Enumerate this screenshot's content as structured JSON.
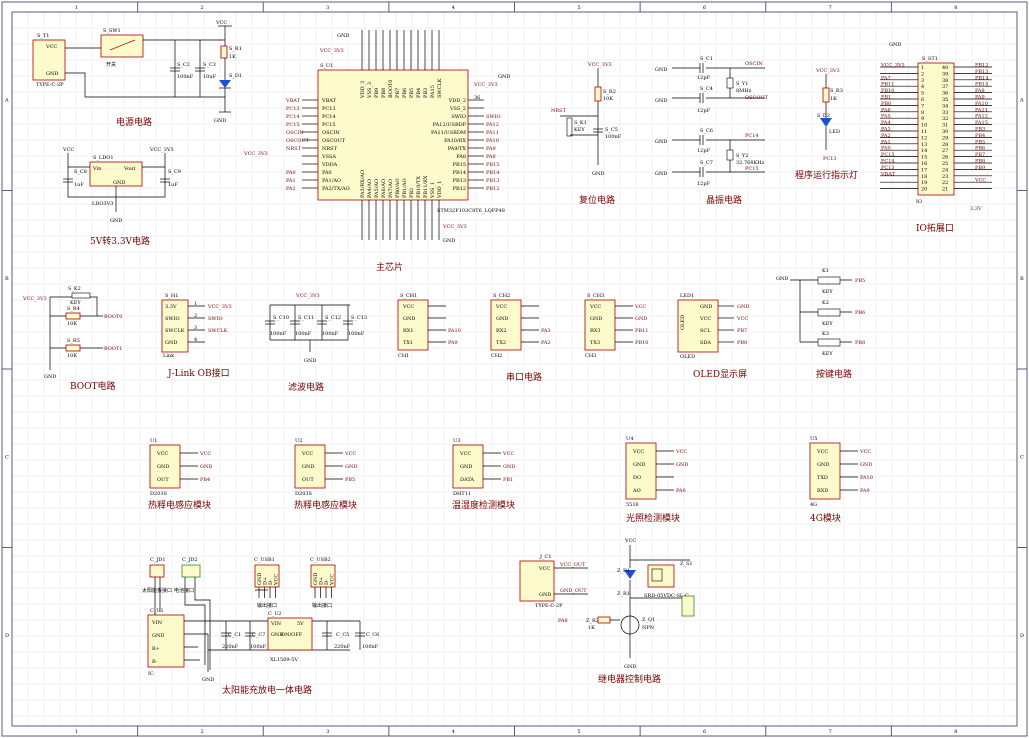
{
  "border": {
    "cols": [
      "1",
      "2",
      "3",
      "4",
      "5",
      "6",
      "7",
      "8"
    ],
    "rows": [
      "A",
      "B",
      "C",
      "D"
    ]
  },
  "sections": {
    "power": "电源电路",
    "ldo": "5V转3.3V电路",
    "mcu": "主芯片",
    "reset": "复位电路",
    "crystal": "晶振电路",
    "led_run": "程序运行指示灯",
    "io": "IO拓展口",
    "boot": "BOOT电路",
    "jlink": "J-Link OB接口",
    "filter": "滤波电路",
    "uart": "串口电路",
    "oled": "OLED显示屏",
    "keys": "按键电路",
    "pir1": "热释电感应模块",
    "pir2": "热释电感应模块",
    "temp": "温湿度检测模块",
    "light": "光照检测模块",
    "g4": "4G模块",
    "solar": "太阳能充放电一体电路",
    "relay": "继电器控制电路"
  },
  "mcu": {
    "ref": "S_U1",
    "part": "STM32F103C8T6_LQFP48",
    "left_pins": [
      "VBAT",
      "PC13",
      "PC14",
      "PC15",
      "OSCIN",
      "OSCOUT",
      "NRST",
      "VSSA",
      "VDDA",
      "PA0",
      "PA1/AO",
      "PA2/TX/AO"
    ],
    "right_pins": [
      "VDD_2",
      "VSS_2",
      "SWIO",
      "PA12/USBDP",
      "PA11/USBDM",
      "PA10/RX",
      "PA9/TX",
      "PA8",
      "PB15",
      "PB14",
      "PB13",
      "PB12"
    ],
    "top_pins": [
      "VDD_3",
      "VSS_3",
      "PB9",
      "PB8",
      "BOOT0",
      "PB7",
      "PB6",
      "PB5",
      "PB4",
      "PB3",
      "PA15",
      "SWCLK"
    ],
    "bottom_pins": [
      "PA3/RX/AO",
      "PA4/AO",
      "PA5/AO",
      "PA6/AO",
      "PA7/AO",
      "PB0/AO",
      "PB1/AO",
      "PB2",
      "PB10/TX",
      "PB11/RX",
      "VSS_1",
      "VDD_1"
    ],
    "left_nets": [
      "VBAT",
      "PC13",
      "PC14",
      "PC15",
      "OSCIN",
      "OSCOUT",
      "NRST",
      "",
      "",
      "PA0",
      "PA1",
      "PA2"
    ],
    "right_nets": [
      "",
      "",
      "SWIO",
      "PA12",
      "PA11",
      "PA10",
      "PA9",
      "PA8",
      "PB15",
      "PB14",
      "PB13",
      "PB12"
    ],
    "vcc_left": "VCC_3V3",
    "vcc_top": "VCC_3V3",
    "vcc_right": "VCC_3V3",
    "vcc_bottom": "VCC_3V3",
    "gnd": "GND",
    "pin_36": "36"
  },
  "power": {
    "j_ref": "S_T1",
    "j_part": "TYPE-C-2P",
    "j_vcc": "VCC",
    "j_gnd": "GND",
    "sw_ref": "S_SW1",
    "sw_part": "开关",
    "c2": "S_C2",
    "c2_val": "100nF",
    "c3": "S_C3",
    "c3_val": "10uF",
    "r1": "S_R1",
    "r1_val": "1K",
    "d1": "S_D1",
    "vcc": "VCC",
    "gnd": "GND"
  },
  "ldo": {
    "ref": "S_LDO1",
    "part": "LDO3V3",
    "vin": "Vin",
    "vout": "Vout",
    "gnd": "GND",
    "c8": "S_C8",
    "c8_val": "1uF",
    "c9": "S_C9",
    "c9_val": "1uF",
    "vcc_in": "VCC",
    "vcc_out": "VCC_3V3",
    "ground": "GND"
  },
  "reset": {
    "vcc": "VCC_3V3",
    "r2": "S_R2",
    "r2_val": "10K",
    "k1": "S_K1",
    "k1_val": "KEY",
    "c5": "S_C5",
    "c5_val": "100nF",
    "nrst": "NRST",
    "gnd": "GND"
  },
  "crystal": {
    "c1": "S_C1",
    "c4": "S_C4",
    "c6": "S_C6",
    "c7": "S_C7",
    "cap_val": "12pF",
    "y1": "S_Y1",
    "y1_val": "8MHz",
    "y2": "S_Y2",
    "y2_val": "32.768KHz",
    "oscin": "OSCIN",
    "oscout": "OSCOUT",
    "pc14": "PC14",
    "pc15": "PC15",
    "gnd": "GND"
  },
  "run_led": {
    "vcc": "VCC_3V3",
    "r3": "S_R3",
    "r3_val": "1K",
    "d2": "S_D2",
    "led": "LED",
    "net": "PC13"
  },
  "io": {
    "ref": "S_ST1",
    "name": "IO",
    "left_nums": [
      "1",
      "2",
      "3",
      "4",
      "5",
      "6",
      "7",
      "8",
      "9",
      "10",
      "11",
      "12",
      "13",
      "14",
      "15",
      "16",
      "17",
      "18",
      "19",
      "20"
    ],
    "right_nums": [
      "40",
      "39",
      "38",
      "37",
      "36",
      "35",
      "34",
      "33",
      "32",
      "31",
      "30",
      "29",
      "28",
      "27",
      "26",
      "25",
      "24",
      "23",
      "22",
      "21"
    ],
    "left_nets": [
      "VCC_3V3",
      "",
      "PA7",
      "PB11",
      "PB10",
      "PB1",
      "PB0",
      "PA6",
      "PA5",
      "PA4",
      "PA3",
      "PA2",
      "PA1",
      "PA0",
      "PC15",
      "PC14",
      "PC13",
      "VBAT",
      "",
      ""
    ],
    "right_nets": [
      "PB12",
      "PB13",
      "PB14",
      "PB15",
      "PA8",
      "PA9",
      "PA10",
      "PA11",
      "PA12",
      "PA15",
      "PB3",
      "PB4",
      "PB5",
      "PB6",
      "PB7",
      "PB8",
      "PB9",
      "",
      "VCC",
      ""
    ],
    "gnd": "GND",
    "vcc_bottom": "3.3V"
  },
  "boot": {
    "vcc": "VCC_3V3",
    "k2": "S_K2",
    "k2_val": "KEY",
    "r4": "S_R4",
    "r4_val": "10K",
    "r5": "S_R5",
    "r5_val": "10K",
    "net1": "BOOT0",
    "net2": "BOOT1",
    "gnd": "GND"
  },
  "jlink": {
    "ref": "S_H1",
    "name": "Link",
    "pins": [
      "3.3V",
      "SWIO",
      "SWCLK",
      "GND"
    ],
    "nums": [
      "1",
      "2",
      "3",
      "4"
    ],
    "nets": [
      "VCC_3V3",
      "SWIO",
      "SWCLK",
      ""
    ]
  },
  "filter": {
    "vcc": "VCC_3V3",
    "caps": [
      "S_C10",
      "S_C11",
      "S_C12",
      "S_C13"
    ],
    "val": "100nF",
    "gnd": "GND"
  },
  "uart": [
    {
      "ref": "S_CH1",
      "name": "CH1",
      "pins": [
        "VCC",
        "GND",
        "RX1",
        "TX1"
      ],
      "nets": [
        "",
        "",
        "PA10",
        "PA9"
      ]
    },
    {
      "ref": "S_CH2",
      "name": "CH2",
      "pins": [
        "VCC",
        "GND",
        "RX2",
        "TX2"
      ],
      "nets": [
        "",
        "",
        "PA3",
        "PA2"
      ]
    },
    {
      "ref": "S_CH3",
      "name": "CH3",
      "pins": [
        "VCC",
        "GND",
        "RX3",
        "TX3"
      ],
      "nets": [
        "VCC",
        "GND",
        "PB11",
        "PB10"
      ]
    }
  ],
  "oled": {
    "ref": "LED1",
    "name": "OLED",
    "label": "OLED",
    "pins": [
      "GND",
      "VCC",
      "SCL",
      "SDA"
    ],
    "nets": [
      "GND",
      "VCC",
      "PB7",
      "PB8"
    ]
  },
  "keys": {
    "k1": "K1",
    "k2": "K2",
    "k3": "K3",
    "val": "KEY",
    "gnd": "GND",
    "nets": [
      "PB5",
      "PB6",
      "PB8"
    ]
  },
  "sensors": [
    {
      "ref": "U1",
      "name": "D203S",
      "pins": [
        "VCC",
        "GND",
        "OUT"
      ],
      "nets": [
        "VCC",
        "GND",
        "PB4"
      ]
    },
    {
      "ref": "U2",
      "name": "D203S",
      "pins": [
        "VCC",
        "GND",
        "OUT"
      ],
      "nets": [
        "VCC",
        "GND",
        "PB5"
      ]
    },
    {
      "ref": "U3",
      "name": "DHT11",
      "pins": [
        "VCC",
        "GND",
        "DATA"
      ],
      "nets": [
        "VCC",
        "GND",
        "PB1"
      ]
    },
    {
      "ref": "U4",
      "name": "5516",
      "pins": [
        "VCC",
        "GND",
        "DO",
        "AO"
      ],
      "nets": [
        "VCC",
        "GND",
        "",
        "PA0"
      ]
    },
    {
      "ref": "U5",
      "name": "4G",
      "pins": [
        "VCC",
        "GND",
        "TXD",
        "RXD"
      ],
      "nets": [
        "VCC",
        "GND",
        "PA10",
        "PA9"
      ]
    }
  ],
  "solar": {
    "jd1": "C_JD1",
    "jd2": "C_JD2",
    "jd1_lbl": "太阳能板接口",
    "jd2_lbl": "电池接口",
    "u1": "C_U1",
    "u1_name": "IC",
    "u1_pins": [
      "VIN",
      "GND",
      "B+",
      "B-"
    ],
    "usb1": "C_USB1",
    "usb2": "C_USB2",
    "usb_pins": [
      "GND",
      "D+",
      "D-",
      "VCC"
    ],
    "usb_lbl": "输出接口",
    "u2": "C_U2",
    "u2_part": "XL1509-5V",
    "u2_pins": [
      "VIN",
      "GND",
      "5V",
      "ON/OFF"
    ],
    "c1": "C_C1",
    "c7": "C_C7",
    "c5": "C_C5",
    "c6": "C_C6",
    "c1_val": "220nF",
    "c7_val": "100nF",
    "c5_val": "220nF",
    "c6_val": "100nF",
    "gnd": "GND"
  },
  "j_c1": {
    "ref": "J_C1",
    "part": "TYPE-C-2P",
    "vcc": "VCC",
    "gnd": "GND",
    "net_vcc": "VCC_OUT",
    "net_gnd": "GND_OUT"
  },
  "relay": {
    "vcc": "VCC",
    "d1": "Z_D1",
    "r1": "Z_R1",
    "r2": "Z_R2",
    "r2_val": "1K",
    "q1": "Z_Q1",
    "q1_val": "NPN",
    "k1": "Z_K1",
    "k1_val": "SRD-05VDC-SL-C",
    "s1": "Z_S1",
    "net": "PA8",
    "gnd": "GND",
    "vcc_out": "VCC_OUT",
    "gnd_out": "GND_OUT"
  }
}
